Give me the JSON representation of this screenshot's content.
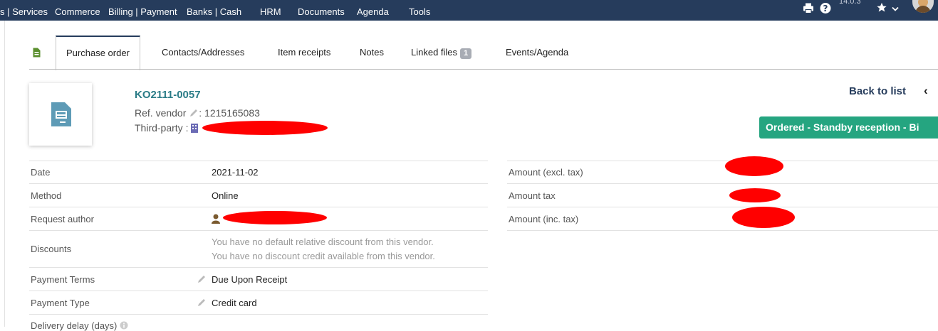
{
  "topmenu": {
    "items": [
      "s | Services",
      "Commerce",
      "Billing | Payment",
      "Banks | Cash",
      "HRM",
      "Documents",
      "Agenda",
      "Tools"
    ],
    "version": "14.0.3"
  },
  "tabs": {
    "purchase_order": "Purchase order",
    "contacts": "Contacts/Addresses",
    "item_receipts": "Item receipts",
    "notes": "Notes",
    "linked_files": "Linked files",
    "linked_files_count": "1",
    "events": "Events/Agenda"
  },
  "header": {
    "ref": "KO2111-0057",
    "ref_vendor_label": "Ref. vendor",
    "ref_vendor_value": ": 1215165083",
    "third_party_label": "Third-party :",
    "back_to_list": "Back to list",
    "status": "Ordered - Standby reception - Bi"
  },
  "fields_left": {
    "date_label": "Date",
    "date_value": "2021-11-02",
    "method_label": "Method",
    "method_value": "Online",
    "request_author_label": "Request author",
    "discounts_label": "Discounts",
    "discounts_line1": "You have no default relative discount from this vendor.",
    "discounts_line2": "You have no discount credit available from this vendor.",
    "payment_terms_label": "Payment Terms",
    "payment_terms_value": "Due Upon Receipt",
    "payment_type_label": "Payment Type",
    "payment_type_value": "Credit card",
    "delivery_delay_label": "Delivery delay (days)"
  },
  "fields_right": {
    "amount_excl_label": "Amount (excl. tax)",
    "amount_tax_label": "Amount tax",
    "amount_inc_label": "Amount (inc. tax)"
  },
  "colors": {
    "topbar": "#263c5c",
    "ref_link": "#2b7c87",
    "status": "#25a580"
  }
}
